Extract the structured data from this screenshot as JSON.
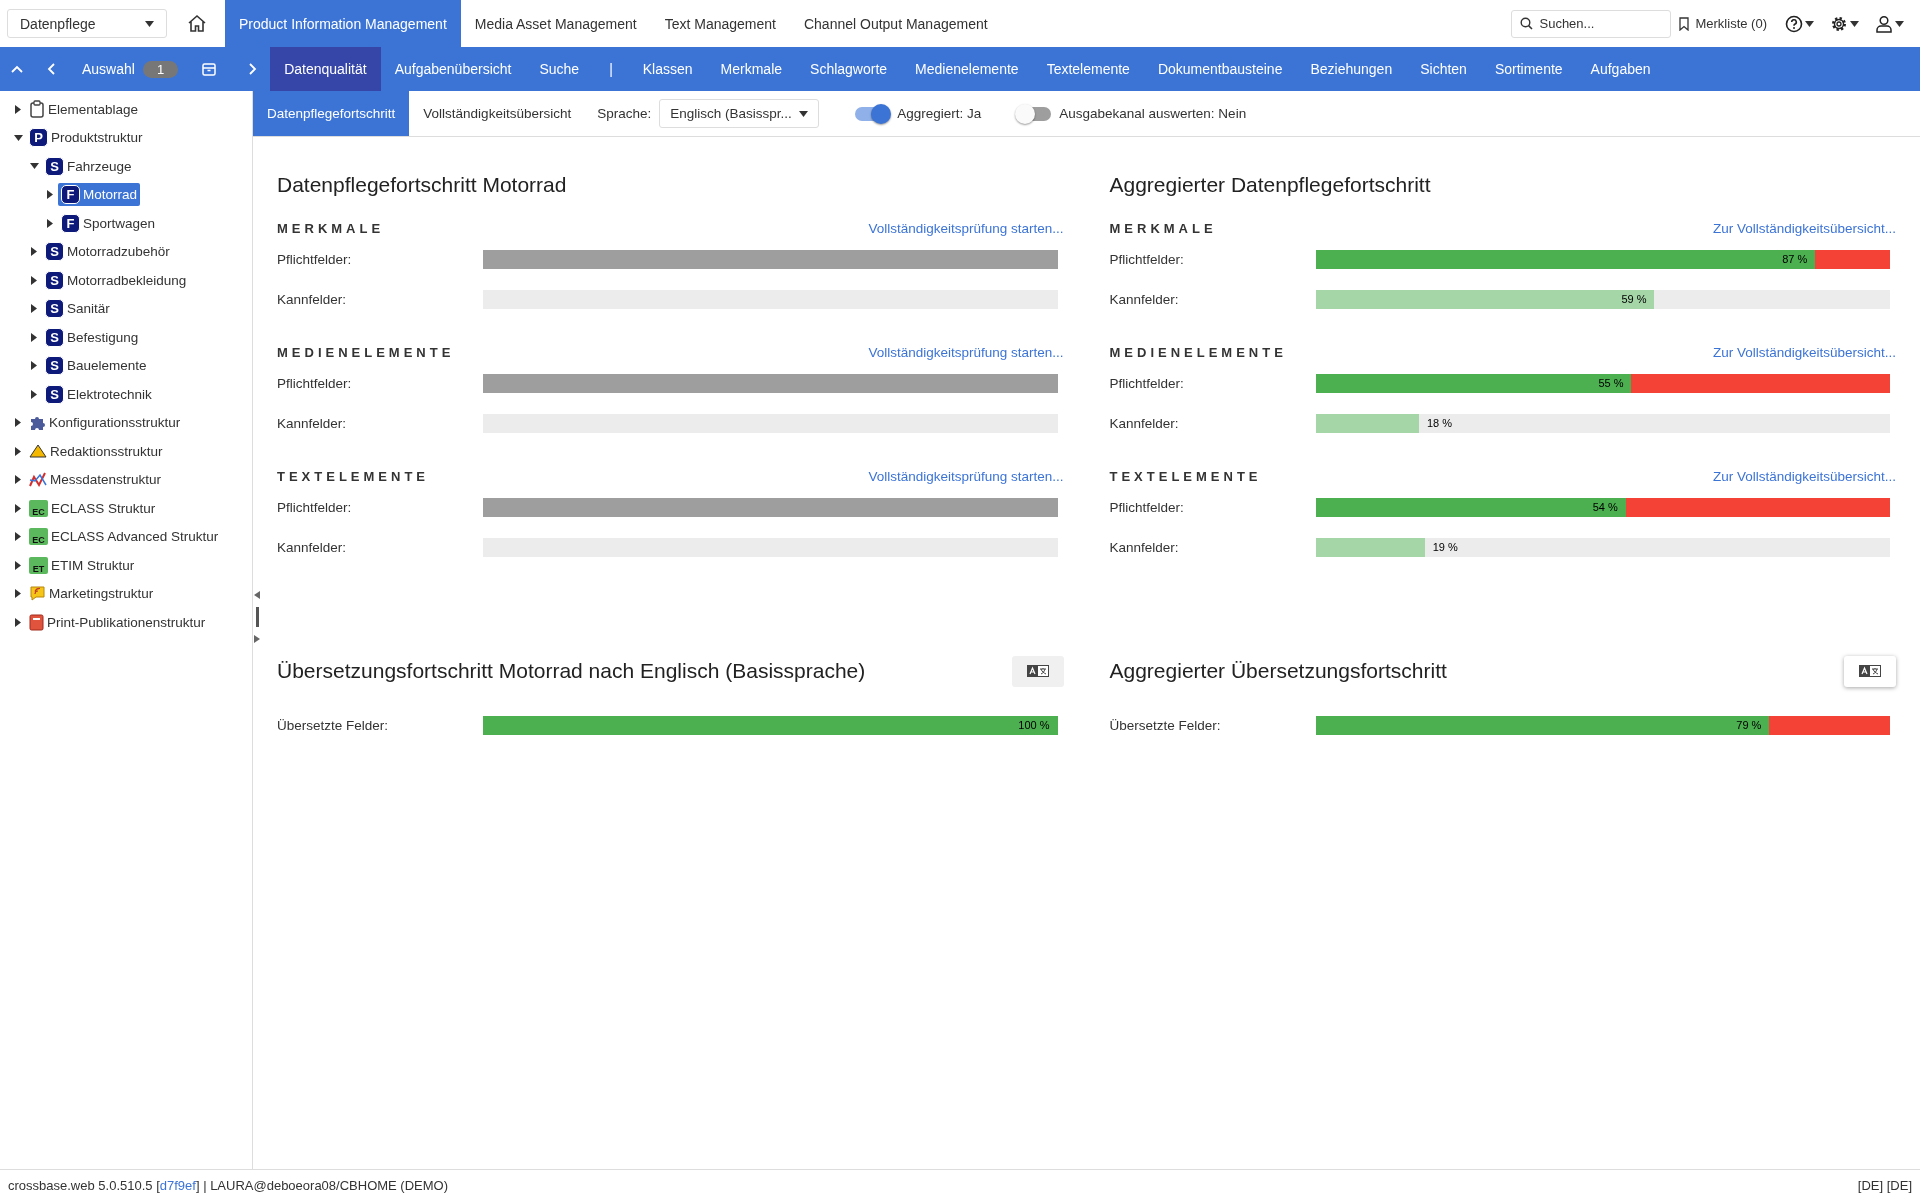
{
  "top_bar": {
    "workspace_select": "Datenpflege",
    "modules": [
      {
        "label": "Product Information Management",
        "selected": true
      },
      {
        "label": "Media Asset Management",
        "selected": false
      },
      {
        "label": "Text Management",
        "selected": false
      },
      {
        "label": "Channel Output Management",
        "selected": false
      }
    ],
    "search": {
      "placeholder": "Suchen..."
    },
    "watchlist": "Merkliste (0)"
  },
  "nav_bar": {
    "selection_label": "Auswahl",
    "selection_count": "1",
    "items": [
      {
        "label": "Datenqualität",
        "kind": "tab",
        "selected": true
      },
      {
        "label": "Aufgabenübersicht",
        "kind": "tab",
        "selected": false
      },
      {
        "label": "Suche",
        "kind": "tab",
        "selected": false
      },
      {
        "label": "|",
        "kind": "separator"
      },
      {
        "label": "Klassen",
        "kind": "tab",
        "selected": false
      },
      {
        "label": "Merkmale",
        "kind": "tab",
        "selected": false
      },
      {
        "label": "Schlagworte",
        "kind": "tab",
        "selected": false
      },
      {
        "label": "Medienelemente",
        "kind": "tab",
        "selected": false
      },
      {
        "label": "Textelemente",
        "kind": "tab",
        "selected": false
      },
      {
        "label": "Dokumentbausteine",
        "kind": "tab",
        "selected": false
      },
      {
        "label": "Beziehungen",
        "kind": "tab",
        "selected": false
      },
      {
        "label": "Sichten",
        "kind": "tab",
        "selected": false
      },
      {
        "label": "Sortimente",
        "kind": "tab",
        "selected": false
      },
      {
        "label": "Aufgaben",
        "kind": "tab",
        "selected": false
      }
    ]
  },
  "tree": [
    {
      "label": "Elementablage",
      "kind": "clipboard",
      "expanded": false,
      "selected": false
    },
    {
      "label": "Produktstruktur",
      "kind": "letter",
      "badge": "P",
      "expanded": true,
      "selected": false,
      "children": [
        {
          "label": "Fahrzeuge",
          "kind": "letter",
          "badge": "S",
          "expanded": true,
          "selected": false,
          "children": [
            {
              "label": "Motorrad",
              "kind": "letter",
              "badge": "F",
              "expanded": false,
              "selected": true
            },
            {
              "label": "Sportwagen",
              "kind": "letter",
              "badge": "F",
              "expanded": false,
              "selected": false
            }
          ]
        },
        {
          "label": "Motorradzubehör",
          "kind": "letter",
          "badge": "S",
          "expanded": false,
          "selected": false
        },
        {
          "label": "Motorradbekleidung",
          "kind": "letter",
          "badge": "S",
          "expanded": false,
          "selected": false
        },
        {
          "label": "Sanitär",
          "kind": "letter",
          "badge": "S",
          "expanded": false,
          "selected": false
        },
        {
          "label": "Befestigung",
          "kind": "letter",
          "badge": "S",
          "expanded": false,
          "selected": false
        },
        {
          "label": "Bauelemente",
          "kind": "letter",
          "badge": "S",
          "expanded": false,
          "selected": false
        },
        {
          "label": "Elektrotechnik",
          "kind": "letter",
          "badge": "S",
          "expanded": false,
          "selected": false
        }
      ]
    },
    {
      "label": "Konfigurationsstruktur",
      "kind": "puzzle",
      "expanded": false,
      "selected": false
    },
    {
      "label": "Redaktionsstruktur",
      "kind": "triangle",
      "expanded": false,
      "selected": false
    },
    {
      "label": "Messdatenstruktur",
      "kind": "chart",
      "expanded": false,
      "selected": false
    },
    {
      "label": "ECLASS Struktur",
      "kind": "folder",
      "badge": "EC",
      "expanded": false,
      "selected": false
    },
    {
      "label": "ECLASS Advanced Struktur",
      "kind": "folder",
      "badge": "EC",
      "expanded": false,
      "selected": false
    },
    {
      "label": "ETIM Struktur",
      "kind": "folder",
      "badge": "ET",
      "expanded": false,
      "selected": false
    },
    {
      "label": "Marketingstruktur",
      "kind": "speech",
      "expanded": false,
      "selected": false
    },
    {
      "label": "Print-Publikationenstruktur",
      "kind": "book",
      "expanded": false,
      "selected": false
    }
  ],
  "sub_bar": {
    "tabs": [
      {
        "label": "Datenpflegefortschritt",
        "selected": true
      },
      {
        "label": "Vollständigkeitsübersicht",
        "selected": false
      }
    ],
    "language_label": "Sprache:",
    "language_value": "Englisch (Basisspr...",
    "toggles": [
      {
        "label": "Aggregiert: Ja",
        "on": true
      },
      {
        "label": "Ausgabekanal auswerten: Nein",
        "on": false
      }
    ]
  },
  "panels": [
    {
      "title": "Datenpflegefortschritt Motorrad",
      "sections": [
        {
          "title": "MERKMALE",
          "link": "Vollständigkeitsprüfung starten...",
          "bars": [
            {
              "label": "Pflichtfelder:",
              "kind": "required-empty"
            },
            {
              "label": "Kannfelder:",
              "kind": "optional-empty"
            }
          ]
        },
        {
          "title": "MEDIENELEMENTE",
          "link": "Vollständigkeitsprüfung starten...",
          "bars": [
            {
              "label": "Pflichtfelder:",
              "kind": "required-empty"
            },
            {
              "label": "Kannfelder:",
              "kind": "optional-empty"
            }
          ]
        },
        {
          "title": "TEXTELEMENTE",
          "link": "Vollständigkeitsprüfung starten...",
          "bars": [
            {
              "label": "Pflichtfelder:",
              "kind": "required-empty"
            },
            {
              "label": "Kannfelder:",
              "kind": "optional-empty"
            }
          ]
        }
      ]
    },
    {
      "title": "Aggregierter Datenpflegefortschritt",
      "sections": [
        {
          "title": "MERKMALE",
          "link": "Zur Vollständigkeitsübersicht...",
          "bars": [
            {
              "label": "Pflichtfelder:",
              "kind": "required",
              "level": 0.87,
              "reading": "87 %"
            },
            {
              "label": "Kannfelder:",
              "kind": "optional",
              "level": 0.59,
              "reading": "59 %"
            }
          ]
        },
        {
          "title": "MEDIENELEMENTE",
          "link": "Zur Vollständigkeitsübersicht...",
          "bars": [
            {
              "label": "Pflichtfelder:",
              "kind": "required",
              "level": 0.55,
              "reading": "55 %"
            },
            {
              "label": "Kannfelder:",
              "kind": "optional",
              "level": 0.18,
              "reading": "18 %"
            }
          ]
        },
        {
          "title": "TEXTELEMENTE",
          "link": "Zur Vollständigkeitsübersicht...",
          "bars": [
            {
              "label": "Pflichtfelder:",
              "kind": "required",
              "level": 0.54,
              "reading": "54 %"
            },
            {
              "label": "Kannfelder:",
              "kind": "optional",
              "level": 0.19,
              "reading": "19 %"
            }
          ]
        }
      ]
    }
  ],
  "translation_panels": [
    {
      "title": "Übersetzungsfortschritt Motorrad nach Englisch (Basissprache)",
      "highlighted": false,
      "bars": [
        {
          "label": "Übersetzte Felder:",
          "kind": "required",
          "level": 1,
          "reading": "100 %"
        }
      ]
    },
    {
      "title": "Aggregierter Übersetzungsfortschritt",
      "highlighted": true,
      "bars": [
        {
          "label": "Übersetzte Felder:",
          "kind": "required",
          "level": 0.79,
          "reading": "79 %"
        }
      ]
    }
  ],
  "status_bar": {
    "prefix": "crossbase.web 5.0.510.5 [",
    "commit": "d7f9ef",
    "suffix": "] | LAURA@deboeora08/CBHOME (DEMO)",
    "locale": "[DE] [DE]"
  }
}
